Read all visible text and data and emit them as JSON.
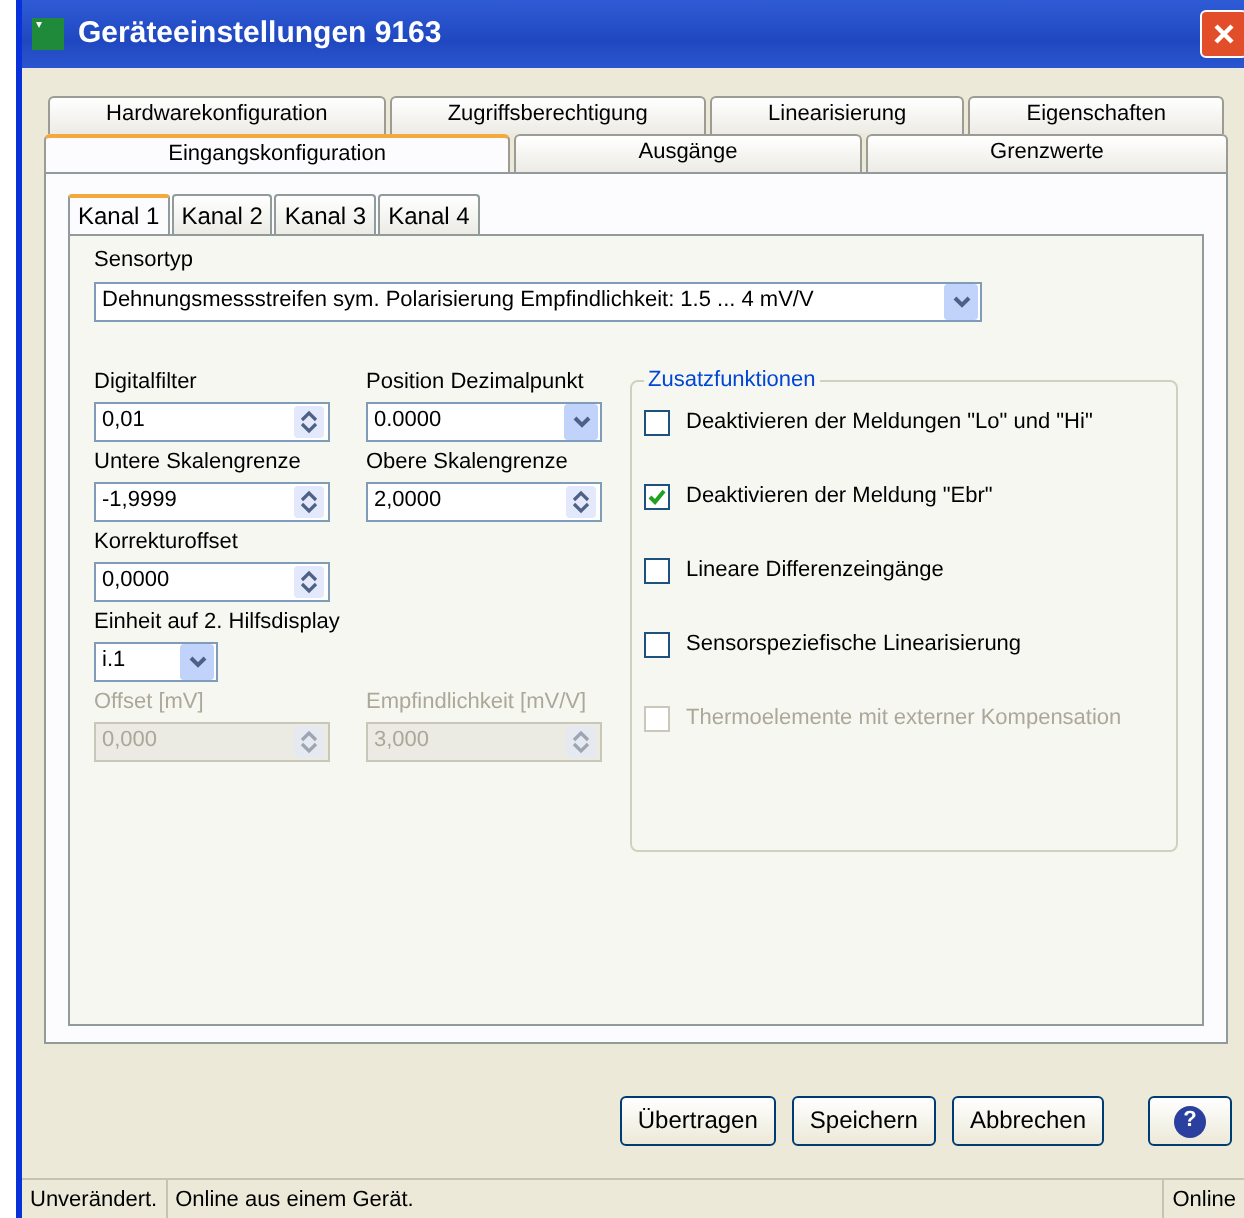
{
  "window": {
    "title": "Geräteeinstellungen 9163"
  },
  "tab_rows": [
    [
      {
        "label": "Hardwarekonfiguration",
        "selected": false
      },
      {
        "label": "Zugriffsberechtigung",
        "selected": false
      },
      {
        "label": "Linearisierung",
        "selected": false
      },
      {
        "label": "Eigenschaften",
        "selected": false
      }
    ],
    [
      {
        "label": "Eingangskonfiguration",
        "selected": true
      },
      {
        "label": "Ausgänge",
        "selected": false
      },
      {
        "label": "Grenzwerte",
        "selected": false
      }
    ]
  ],
  "channel_tabs": [
    {
      "label": "Kanal 1",
      "selected": true
    },
    {
      "label": "Kanal 2",
      "selected": false
    },
    {
      "label": "Kanal 3",
      "selected": false
    },
    {
      "label": "Kanal 4",
      "selected": false
    }
  ],
  "sensor_type": {
    "label": "Sensortyp",
    "value": "Dehnungsmessstreifen sym. Polarisierung Empfindlichkeit: 1.5 ... 4 mV/V"
  },
  "field_rows": [
    [
      {
        "kind": "spin",
        "label": "Digitalfilter",
        "value": "0,01",
        "disabled": false
      },
      {
        "kind": "select",
        "label": "Position Dezimalpunkt",
        "value": "0.0000",
        "disabled": false
      }
    ],
    [
      {
        "kind": "spin",
        "label": "Untere Skalengrenze",
        "value": "-1,9999",
        "disabled": false
      },
      {
        "kind": "spin",
        "label": "Obere Skalengrenze",
        "value": "2,0000",
        "disabled": false
      }
    ],
    [
      {
        "kind": "spin",
        "label": "Korrekturoffset",
        "value": "0,0000",
        "disabled": false
      }
    ],
    [
      {
        "kind": "select-small",
        "label": "Einheit auf 2. Hilfsdisplay",
        "value": "i.1",
        "disabled": false
      }
    ],
    [
      {
        "kind": "spin",
        "label": "Offset [mV]",
        "value": "0,000",
        "disabled": true
      },
      {
        "kind": "spin",
        "label": "Empfindlichkeit [mV/V]",
        "value": "3,000",
        "disabled": true
      }
    ]
  ],
  "group": {
    "title": "Zusatzfunktionen",
    "options": [
      {
        "label": "Deaktivieren der Meldungen \"Lo\" und \"Hi\"",
        "checked": false,
        "disabled": false
      },
      {
        "label": "Deaktivieren der Meldung \"Ebr\"",
        "checked": true,
        "disabled": false
      },
      {
        "label": "Lineare Differenzeingänge",
        "checked": false,
        "disabled": false
      },
      {
        "label": "Sensorspeziefische Linearisierung",
        "checked": false,
        "disabled": false
      },
      {
        "label": "Thermoelemente mit externer Kompensation",
        "checked": false,
        "disabled": true
      }
    ]
  },
  "buttons": [
    {
      "kind": "text",
      "label": "Übertragen"
    },
    {
      "kind": "text",
      "label": "Speichern"
    },
    {
      "kind": "text",
      "label": "Abbrechen"
    },
    {
      "kind": "help",
      "label": "?"
    }
  ],
  "status_bar": [
    "Unverändert.",
    "Online aus einem Gerät.",
    "Online"
  ]
}
